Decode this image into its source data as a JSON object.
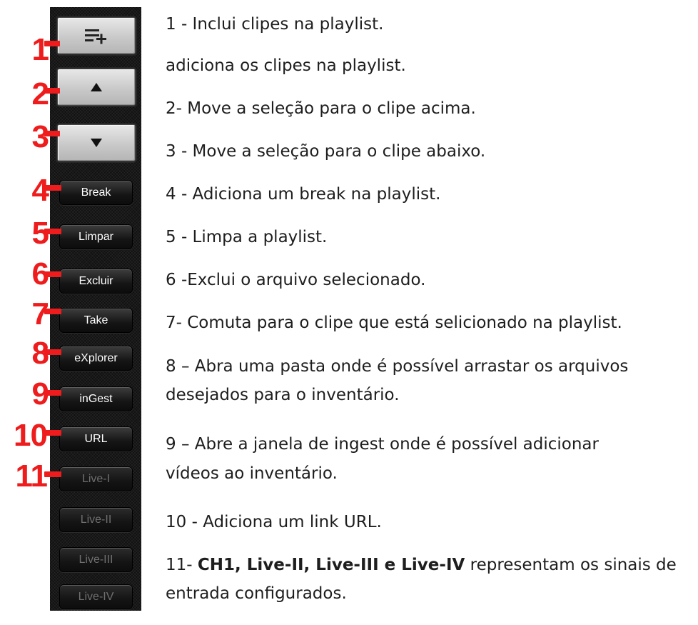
{
  "panel": {
    "add_clips_icon": "playlist-add-icon",
    "up_icon": "triangle-up-icon",
    "down_icon": "triangle-down-icon",
    "buttons": {
      "break": "Break",
      "limpar": "Limpar",
      "excluir": "Excluir",
      "take": "Take",
      "explorer": "eXplorer",
      "ingest": "inGest",
      "url": "URL",
      "live1": "Live-I",
      "live2": "Live-II",
      "live3": "Live-III",
      "live4": "Live-IV"
    }
  },
  "callouts": [
    "1",
    "2",
    "3",
    "4",
    "5",
    "6",
    "7",
    "8",
    "9",
    "10",
    "11"
  ],
  "colors": {
    "callout_red": "#ee1c1c",
    "panel_bg": "#111111",
    "button_text": "#ffffff",
    "disabled_text": "#6f6f6f"
  },
  "descriptions": {
    "d1": "1 - Inclui clipes na playlist.",
    "d1b": "adiciona os clipes na playlist.",
    "d2": "2- Move a seleção para o clipe acima.",
    "d3": "3 - Move a seleção para o clipe abaixo.",
    "d4": "4 - Adiciona um break na playlist.",
    "d5": "5 - Limpa a playlist.",
    "d6": "6 -Exclui o arquivo selecionado.",
    "d7": "7- Comuta para o clipe que está selicionado na playlist.",
    "d8a": "8 – Abra uma pasta onde é possível arrastar os arquivos",
    "d8b": "desejados para o inventário.",
    "d9a": "9 – Abre a janela de ingest onde é possível adicionar",
    "d9b": "vídeos ao inventário.",
    "d10": "10 - Adiciona um link URL.",
    "d11_prefix": "11- ",
    "d11_bold": "CH1, Live-II, Live-III e Live-IV",
    "d11_suffix": " representam os sinais de",
    "d11b": "entrada configurados."
  }
}
